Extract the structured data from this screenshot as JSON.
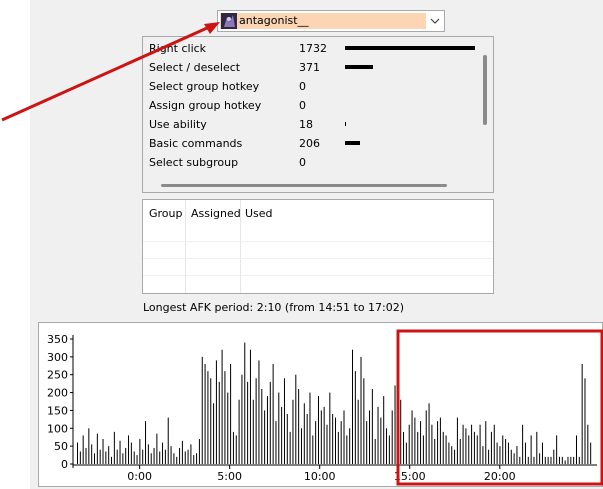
{
  "player_select": {
    "selected": "antagonist__",
    "avatar_icon": "player-portrait-icon",
    "highlight_color": "#fcd5b4"
  },
  "stats": [
    {
      "label": "Right click",
      "value": 1732
    },
    {
      "label": "Select / deselect",
      "value": 371
    },
    {
      "label": "Select group hotkey",
      "value": 0
    },
    {
      "label": "Assign group hotkey",
      "value": 0
    },
    {
      "label": "Use ability",
      "value": 18
    },
    {
      "label": "Basic commands",
      "value": 206
    },
    {
      "label": "Select subgroup",
      "value": 0
    }
  ],
  "hotkey_table": {
    "columns": [
      "Group",
      "Assigned",
      "Used"
    ]
  },
  "afk_text": "Longest AFK period: 2:10 (from 14:51 to 17:02)",
  "chart_data": {
    "type": "bar",
    "y_ticks": [
      0,
      50,
      100,
      150,
      200,
      250,
      300,
      350
    ],
    "ylim": [
      0,
      350
    ],
    "x_ticks": [
      "0:00",
      "5:00",
      "10:00",
      "15:00",
      "20:00"
    ],
    "x_tick_positions": [
      -2.5,
      2.5,
      7.5,
      12.5,
      17.5
    ],
    "x_range": [
      -6.2,
      22.9
    ],
    "values": [
      60,
      35,
      80,
      45,
      100,
      55,
      30,
      85,
      40,
      70,
      35,
      50,
      20,
      90,
      40,
      65,
      30,
      45,
      80,
      60,
      35,
      25,
      70,
      40,
      120,
      55,
      30,
      45,
      85,
      35,
      60,
      40,
      130,
      50,
      30,
      20,
      45,
      65,
      35,
      40,
      55,
      25,
      30,
      70,
      300,
      280,
      260,
      240,
      170,
      290,
      230,
      320,
      260,
      200,
      280,
      90,
      80,
      180,
      250,
      340,
      230,
      320,
      180,
      240,
      290,
      210,
      150,
      190,
      230,
      280,
      120,
      200,
      160,
      240,
      140,
      90,
      180,
      250,
      210,
      100,
      170,
      140,
      200,
      80,
      120,
      190,
      150,
      160,
      110,
      200,
      140,
      130,
      90,
      120,
      150,
      80,
      100,
      320,
      260,
      180,
      300,
      240,
      120,
      150,
      210,
      70,
      160,
      130,
      190,
      100,
      80,
      150,
      220,
      120,
      180,
      90,
      60,
      110,
      150,
      130,
      90,
      120,
      80,
      150,
      170,
      110,
      70,
      120,
      130,
      90,
      80,
      60,
      50,
      40,
      130,
      70,
      110,
      100,
      80,
      110,
      90,
      80,
      110,
      50,
      120,
      40,
      90,
      110,
      60,
      50,
      80,
      70,
      60,
      40,
      30,
      50,
      20,
      110,
      60,
      20,
      80,
      20,
      90,
      30,
      60,
      20,
      20,
      20,
      40,
      80,
      20,
      20,
      10,
      20,
      20,
      20,
      80,
      20,
      280,
      240,
      110,
      60
    ]
  },
  "colors": {
    "annotation": "#cc1414",
    "bars": "#000000"
  }
}
